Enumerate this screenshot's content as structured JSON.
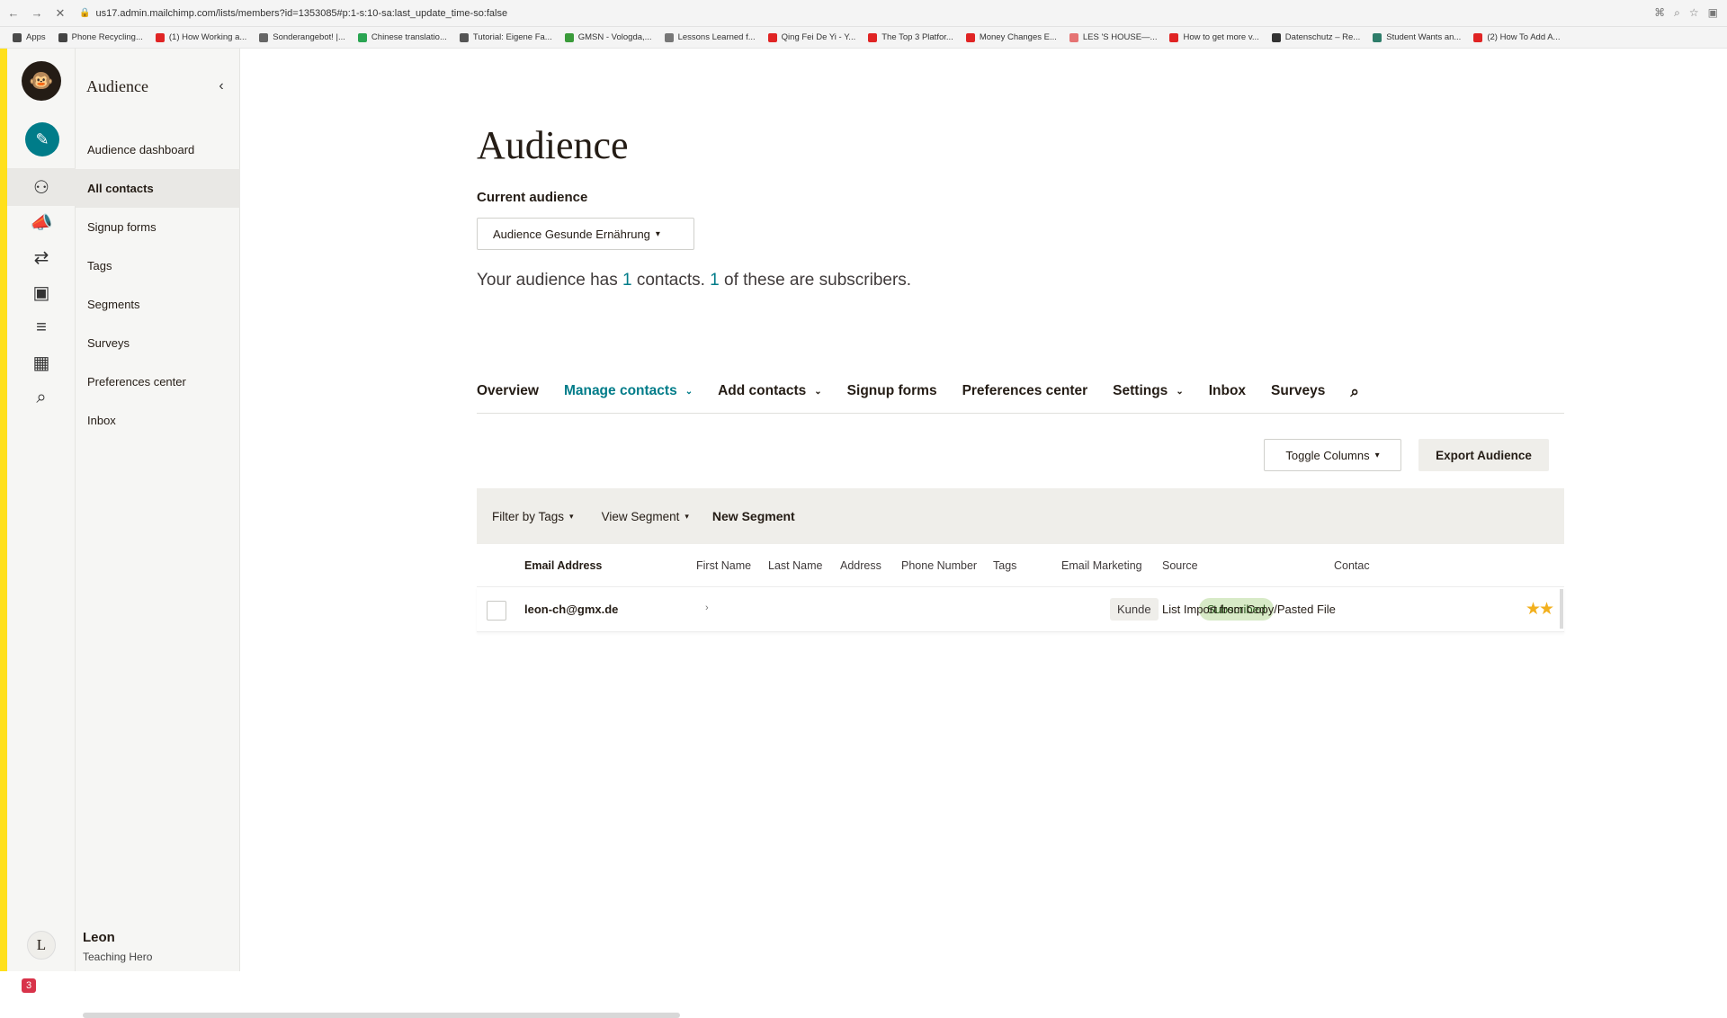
{
  "browser": {
    "url": "us17.admin.mailchimp.com/lists/members?id=1353085#p:1-s:10-sa:last_update_time-so:false",
    "bookmarks": [
      {
        "label": "Apps",
        "color": "#4a4a4a"
      },
      {
        "label": "Phone Recycling...",
        "color": "#444444"
      },
      {
        "label": "(1) How Working a...",
        "color": "#e02424"
      },
      {
        "label": "Sonderangebot! |...",
        "color": "#666666"
      },
      {
        "label": "Chinese translatio...",
        "color": "#2aa552"
      },
      {
        "label": "Tutorial: Eigene Fa...",
        "color": "#555555"
      },
      {
        "label": "GMSN - Vologda,...",
        "color": "#3a9b3a"
      },
      {
        "label": "Lessons Learned f...",
        "color": "#777777"
      },
      {
        "label": "Qing Fei De Yi - Y...",
        "color": "#e02424"
      },
      {
        "label": "The Top 3 Platfor...",
        "color": "#e02424"
      },
      {
        "label": "Money Changes E...",
        "color": "#e02424"
      },
      {
        "label": "LES 'S HOUSE—...",
        "color": "#e57373"
      },
      {
        "label": "How to get more v...",
        "color": "#e02424"
      },
      {
        "label": "Datenschutz – Re...",
        "color": "#333333"
      },
      {
        "label": "Student Wants an...",
        "color": "#2e7d6a"
      },
      {
        "label": "(2) How To Add A...",
        "color": "#e02424"
      }
    ]
  },
  "rail": {
    "logo_icon": "mailchimp-freddie-icon",
    "create_icon": "pencil-icon",
    "items": [
      {
        "name": "audience-icon",
        "glyph": "⚇",
        "active": true
      },
      {
        "name": "campaigns-icon",
        "glyph": "📣",
        "active": false
      },
      {
        "name": "automations-icon",
        "glyph": "⇄",
        "active": false
      },
      {
        "name": "website-icon",
        "glyph": "▣",
        "active": false
      },
      {
        "name": "content-icon",
        "glyph": "≡",
        "active": false
      },
      {
        "name": "integrations-icon",
        "glyph": "▦",
        "active": false
      },
      {
        "name": "search-icon",
        "glyph": "⌕",
        "active": false
      }
    ],
    "notification_count": "3",
    "avatar_initial": "L"
  },
  "sidebar": {
    "title": "Audience",
    "items": [
      {
        "label": "Audience dashboard",
        "active": false
      },
      {
        "label": "All contacts",
        "active": true
      },
      {
        "label": "Signup forms",
        "active": false
      },
      {
        "label": "Tags",
        "active": false
      },
      {
        "label": "Segments",
        "active": false
      },
      {
        "label": "Surveys",
        "active": false
      },
      {
        "label": "Preferences center",
        "active": false
      },
      {
        "label": "Inbox",
        "active": false
      }
    ],
    "user": {
      "name": "Leon",
      "role": "Teaching Hero"
    }
  },
  "main": {
    "title": "Audience",
    "current_audience_label": "Current audience",
    "audience_select": "Audience Gesunde Ernährung",
    "summary": {
      "prefix": "Your audience has ",
      "contacts": "1",
      "middle": " contacts. ",
      "subscribers": "1",
      "suffix": " of these are subscribers."
    },
    "tabs": [
      {
        "label": "Overview",
        "dropdown": false,
        "active": false
      },
      {
        "label": "Manage contacts",
        "dropdown": true,
        "active": true
      },
      {
        "label": "Add contacts",
        "dropdown": true,
        "active": false
      },
      {
        "label": "Signup forms",
        "dropdown": false,
        "active": false
      },
      {
        "label": "Preferences center",
        "dropdown": false,
        "active": false
      },
      {
        "label": "Settings",
        "dropdown": true,
        "active": false
      },
      {
        "label": "Inbox",
        "dropdown": false,
        "active": false
      },
      {
        "label": "Surveys",
        "dropdown": false,
        "active": false
      }
    ],
    "toggle_columns": "Toggle Columns",
    "export_audience": "Export Audience",
    "filters": {
      "filter_by_tags": "Filter by Tags",
      "view_segment": "View Segment",
      "new_segment": "New Segment"
    },
    "table": {
      "columns": [
        "Email Address",
        "First Name",
        "Last Name",
        "Address",
        "Phone Number",
        "Tags",
        "Email Marketing",
        "Source",
        "Contac"
      ],
      "rows": [
        {
          "email": "leon-ch@gmx.de",
          "first_name": "",
          "last_name": "",
          "address": "",
          "phone": "",
          "tag": "Kunde",
          "email_marketing": "Subscribed",
          "source": "List Import from Copy/Pasted File",
          "rating": "★★"
        }
      ]
    }
  },
  "colors": {
    "brand_yellow": "#ffe01b",
    "accent_teal": "#007c89",
    "subscribed_green": "#d7eac7",
    "star": "#f2b01e"
  }
}
